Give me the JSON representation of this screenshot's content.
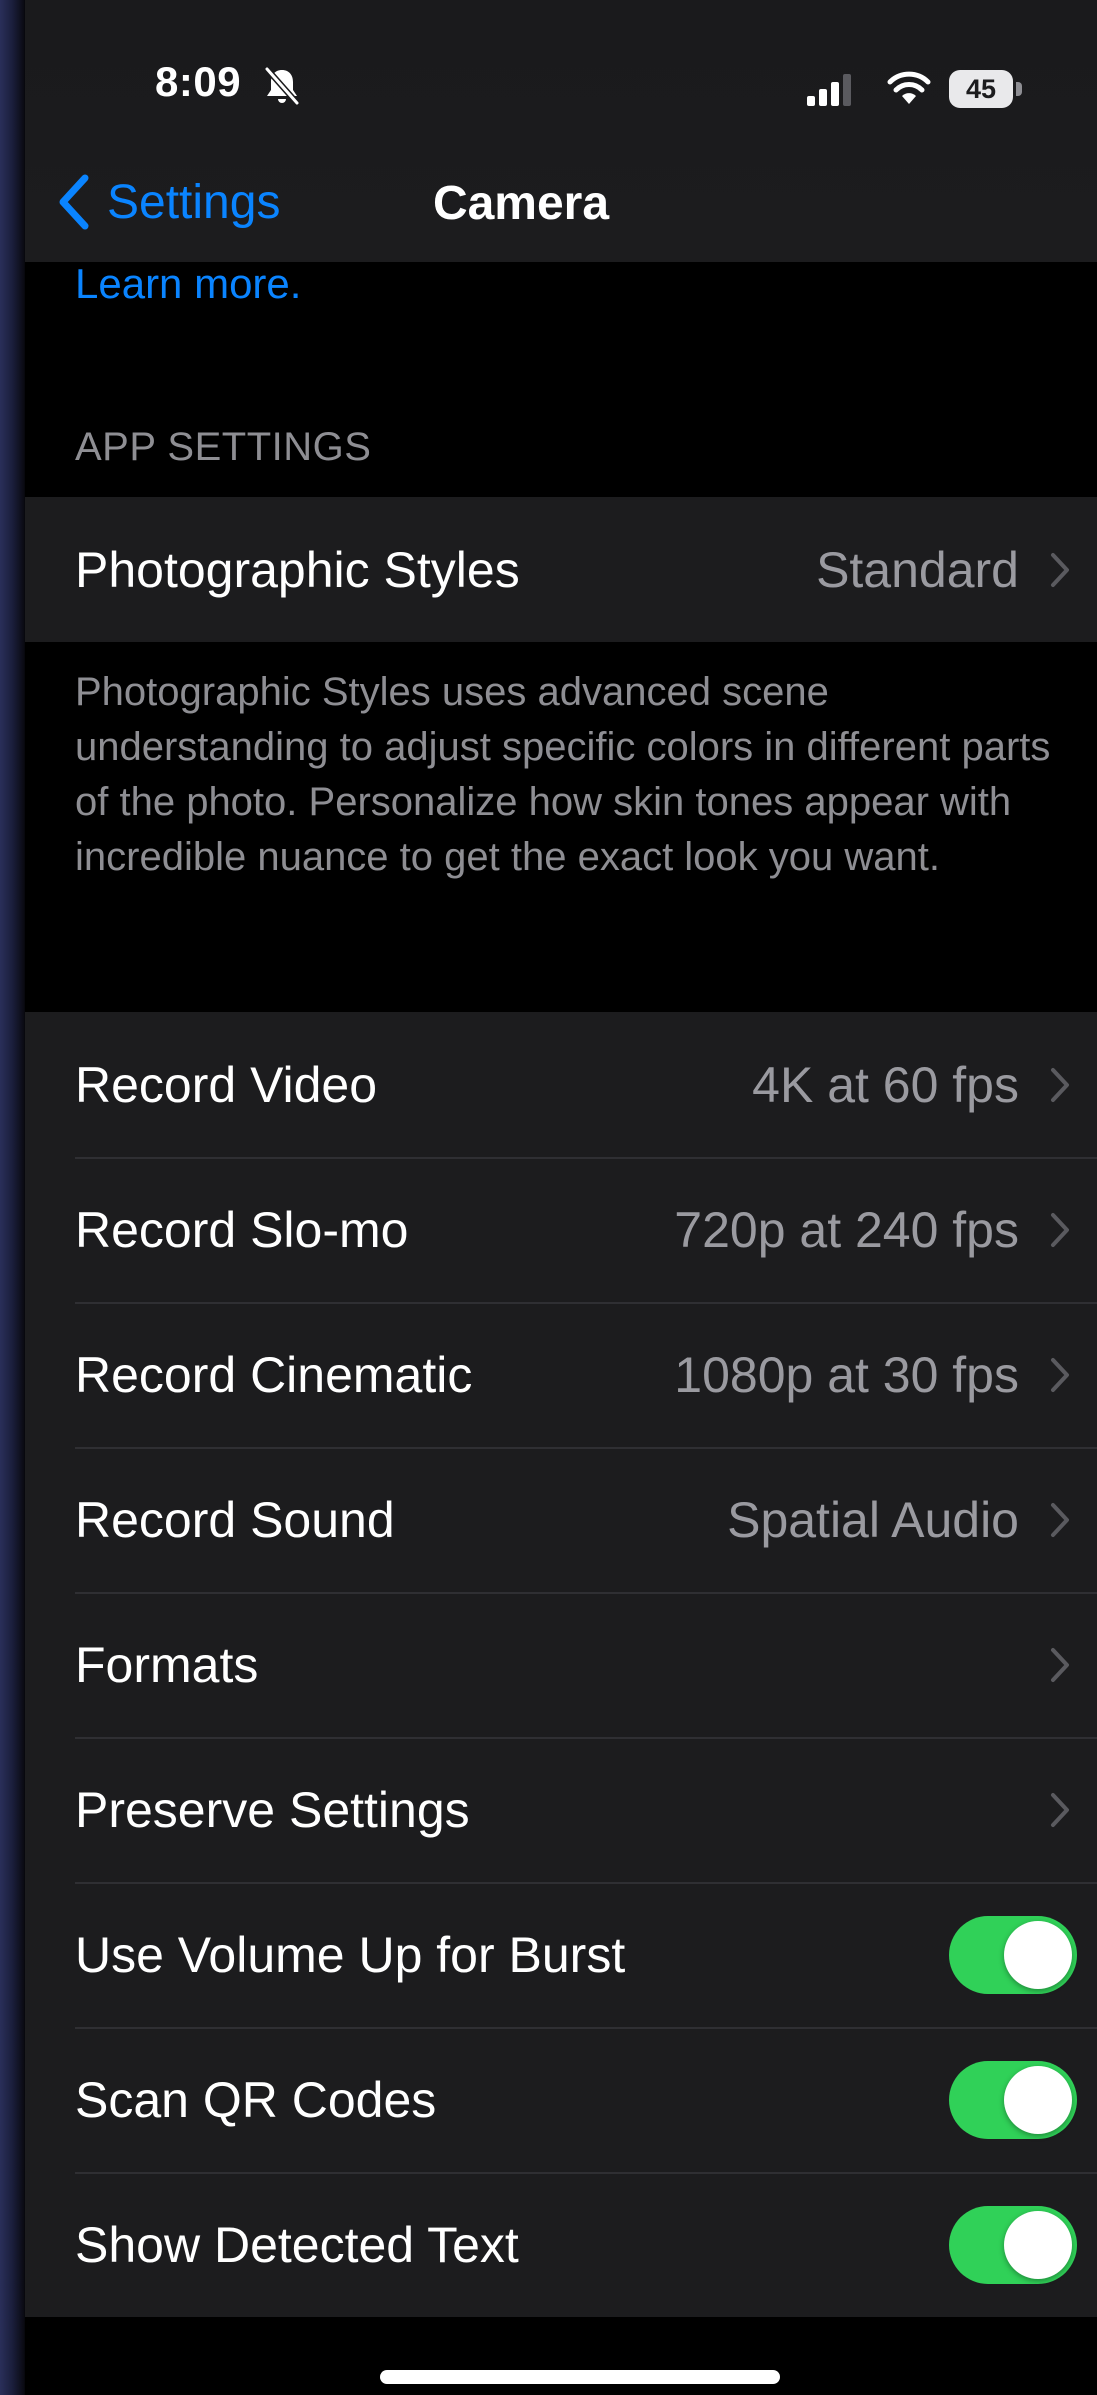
{
  "status_bar": {
    "time": "8:09",
    "battery_level": "45",
    "icons": [
      "bell-slash-icon",
      "cellular-signal-icon",
      "wifi-icon",
      "battery-icon"
    ]
  },
  "nav": {
    "back_label": "Settings",
    "title": "Camera"
  },
  "learn_more": "Learn more.",
  "app_settings": {
    "header": "APP SETTINGS",
    "photographic_styles": {
      "label": "Photographic Styles",
      "value": "Standard"
    },
    "footer": "Photographic Styles uses advanced scene understanding to adjust specific colors in different parts of the photo. Personalize how skin tones appear with incredible nuance to get the exact look you want."
  },
  "settings_rows": [
    {
      "label": "Record Video",
      "value": "4K at 60 fps"
    },
    {
      "label": "Record Slo-mo",
      "value": "720p at 240 fps"
    },
    {
      "label": "Record Cinematic",
      "value": "1080p at 30 fps"
    },
    {
      "label": "Record Sound",
      "value": "Spatial Audio"
    },
    {
      "label": "Formats",
      "value": ""
    },
    {
      "label": "Preserve Settings",
      "value": ""
    }
  ],
  "toggle_rows": [
    {
      "label": "Use Volume Up for Burst",
      "on": true
    },
    {
      "label": "Scan QR Codes",
      "on": true
    },
    {
      "label": "Show Detected Text",
      "on": true
    }
  ],
  "colors": {
    "accent": "#0a84ff",
    "toggle_on": "#30d158",
    "cell_background": "#1c1c1e",
    "secondary_text": "#8e8e93"
  }
}
